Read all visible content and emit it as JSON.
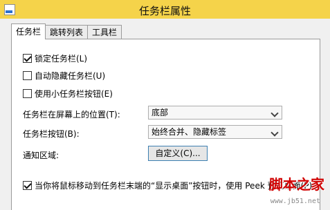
{
  "window": {
    "title": "任务栏属性"
  },
  "tabs": [
    {
      "label": "任务栏",
      "active": true
    },
    {
      "label": "跳转列表",
      "active": false
    },
    {
      "label": "工具栏",
      "active": false
    }
  ],
  "options": {
    "lock": {
      "label": "锁定任务栏(L)",
      "checked": true
    },
    "autohide": {
      "label": "自动隐藏任务栏(U)",
      "checked": false
    },
    "small": {
      "label": "使用小任务栏按钮(E)",
      "checked": false
    }
  },
  "location": {
    "label": "任务栏在屏幕上的位置(T):",
    "value": "底部"
  },
  "buttons": {
    "label": "任务栏按钮(B):",
    "value": "始终合并、隐藏标签"
  },
  "notify": {
    "label": "通知区域:",
    "button": "自定义(C)..."
  },
  "peek": {
    "label": "当你将鼠标移动到任务栏末端的“显示桌面”按钮时，使用 Peek 预览桌面(P)",
    "checked": true
  },
  "watermark": {
    "text": "脚本之家",
    "url": "www.jb51.net"
  },
  "colors": {
    "titlebar": "#f5d34a",
    "accent": "#3c7fb1"
  }
}
